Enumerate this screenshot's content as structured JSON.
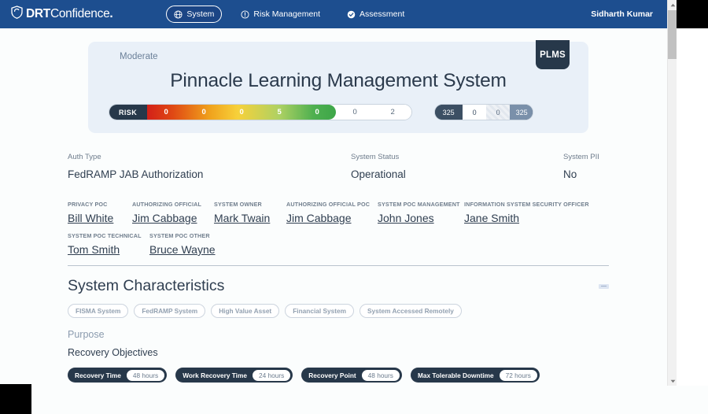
{
  "topnav": {
    "brand": {
      "name_bold": "DRT",
      "name_light": "Confidence",
      "dot": "."
    },
    "items": [
      {
        "label": "System",
        "icon": "globe-icon",
        "active": true
      },
      {
        "label": "Risk Management",
        "icon": "alert-circle-icon",
        "active": false
      },
      {
        "label": "Assessment",
        "icon": "check-circle-icon",
        "active": false
      }
    ],
    "user": "Sidharth Kumar"
  },
  "hero": {
    "category": "Moderate",
    "badge": "PLMS",
    "title": "Pinnacle Learning Management System",
    "risk": {
      "label": "RISK",
      "gradient_values": [
        "0",
        "0",
        "0",
        "5",
        "0"
      ],
      "plain_values": [
        "0",
        "2"
      ]
    },
    "score": {
      "total": "325",
      "a": "0",
      "b": "0",
      "c": "325"
    }
  },
  "info": {
    "auth_type": {
      "label": "Auth Type",
      "value": "FedRAMP JAB Authorization"
    },
    "system_status": {
      "label": "System Status",
      "value": "Operational"
    },
    "system_pii": {
      "label": "System PII",
      "value": "No"
    }
  },
  "pocs": {
    "row1": [
      {
        "label": "PRIVACY POC",
        "name": "Bill White"
      },
      {
        "label": "AUTHORIZING OFFICIAL",
        "name": "Jim Cabbage"
      },
      {
        "label": "SYSTEM OWNER",
        "name": "Mark Twain"
      },
      {
        "label": "AUTHORIZING OFFICIAL POC",
        "name": "Jim Cabbage"
      },
      {
        "label": "SYSTEM POC MANAGEMENT",
        "name": "John Jones"
      },
      {
        "label": "INFORMATION SYSTEM SECURITY OFFICER",
        "name": "Jane Smith"
      }
    ],
    "row2": [
      {
        "label": "SYSTEM POC TECHNICAL",
        "name": "Tom Smith"
      },
      {
        "label": "SYSTEM POC OTHER",
        "name": "Bruce Wayne"
      }
    ]
  },
  "characteristics": {
    "title": "System Characteristics",
    "chips": [
      "FISMA System",
      "FedRAMP System",
      "High Value Asset",
      "Financial System",
      "System Accessed Remotely"
    ],
    "purpose_label": "Purpose",
    "recovery_label": "Recovery Objectives",
    "recovery": [
      {
        "name": "Recovery Time",
        "value": "48 hours"
      },
      {
        "name": "Work Recovery Time",
        "value": "24 hours"
      },
      {
        "name": "Recovery Point",
        "value": "48 hours"
      },
      {
        "name": "Max Tolerable Downtime",
        "value": "72 hours"
      }
    ]
  }
}
